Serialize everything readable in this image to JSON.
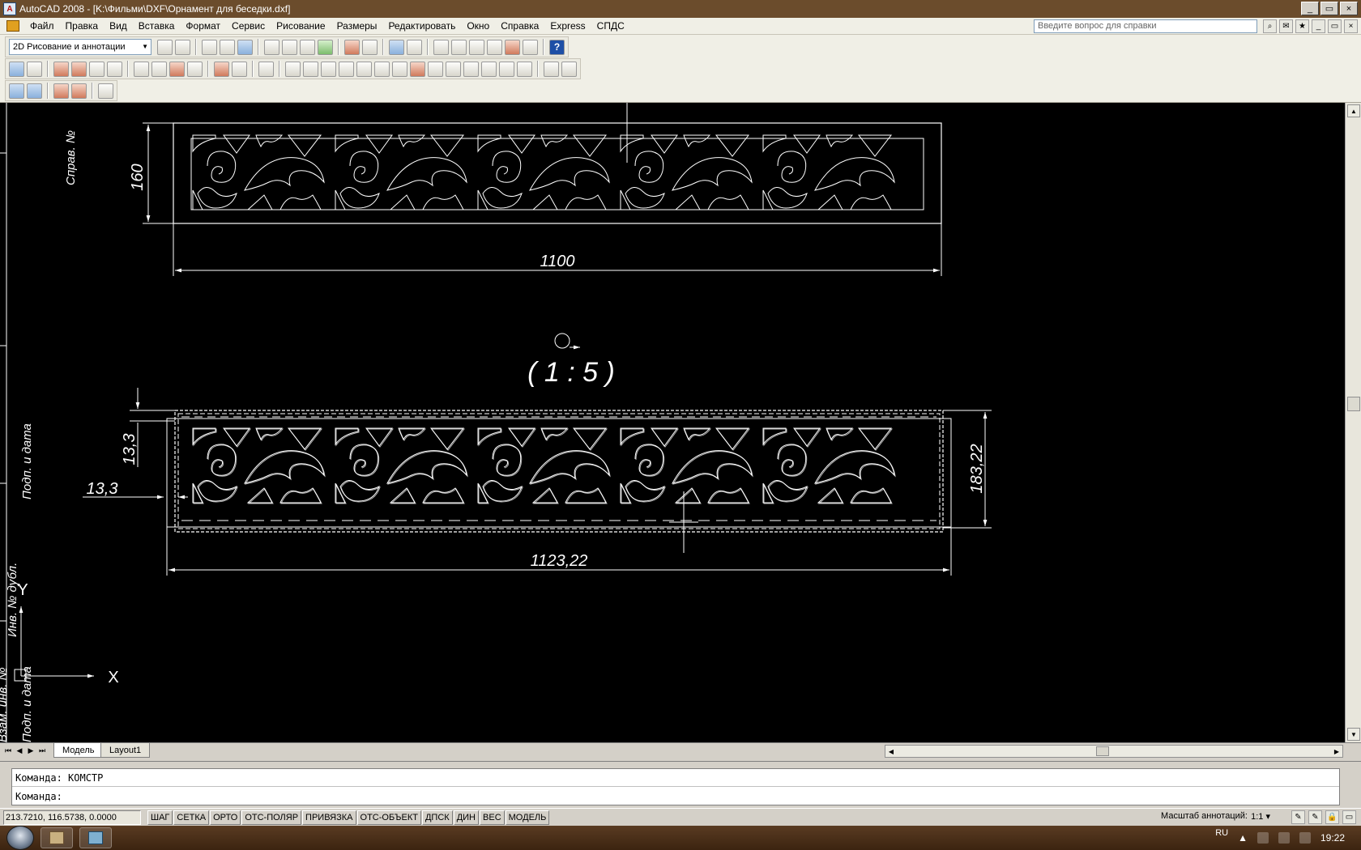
{
  "window": {
    "app_icon": "A",
    "title": "AutoCAD 2008 - [K:\\Фильми\\DXF\\Орнамент для беседки.dxf]",
    "controls": [
      "_",
      "▭",
      "×"
    ]
  },
  "menubar": {
    "items": [
      "Файл",
      "Правка",
      "Вид",
      "Вставка",
      "Формат",
      "Сервис",
      "Рисование",
      "Размеры",
      "Редактировать",
      "Окно",
      "Справка",
      "Express",
      "СПДС"
    ],
    "help_placeholder": "Введите вопрос для справки",
    "right_icons": [
      "search-icon",
      "communication-center-icon",
      "favorites-icon"
    ],
    "doc_controls": [
      "_",
      "▭",
      "×"
    ]
  },
  "toolbar": {
    "workspace": "2D Рисование и аннотации",
    "help_label": "?"
  },
  "drawing": {
    "background": "#000000",
    "stroke": "#ffffff",
    "title_block_texts": [
      "Справ. №",
      "Подп. и дата",
      "Инв. № дубл.",
      "Взам. инв. №",
      "Подп. и дата"
    ],
    "top_panel": {
      "width_dim": "1100",
      "height_dim": "160"
    },
    "scale_label": "( 1 : 5 )",
    "bottom_panel": {
      "width_dim": "1123,22",
      "height_dim": "183,22",
      "offset_v_dim": "13,3",
      "offset_h_dim": "13,3"
    },
    "ucs": {
      "x_label": "X",
      "y_label": "Y"
    }
  },
  "tabs": {
    "active": "Модель",
    "other": "Layout1"
  },
  "command": {
    "line1": "Команда:  КОМСТР",
    "line2": "Команда:"
  },
  "status": {
    "coords": "213.7210, 116.5738, 0.0000",
    "toggles": [
      "ШАГ",
      "СЕТКА",
      "ОРТО",
      "ОТС-ПОЛЯР",
      "ПРИВЯЗКА",
      "ОТС-ОБЪЕКТ",
      "ДПСК",
      "ДИН",
      "ВЕС",
      "МОДЕЛЬ"
    ],
    "annotation_scale_label": "Масштаб аннотаций:",
    "annotation_scale_value": "1:1 ▾"
  },
  "taskbar": {
    "lang": "RU",
    "time": "19:22"
  }
}
